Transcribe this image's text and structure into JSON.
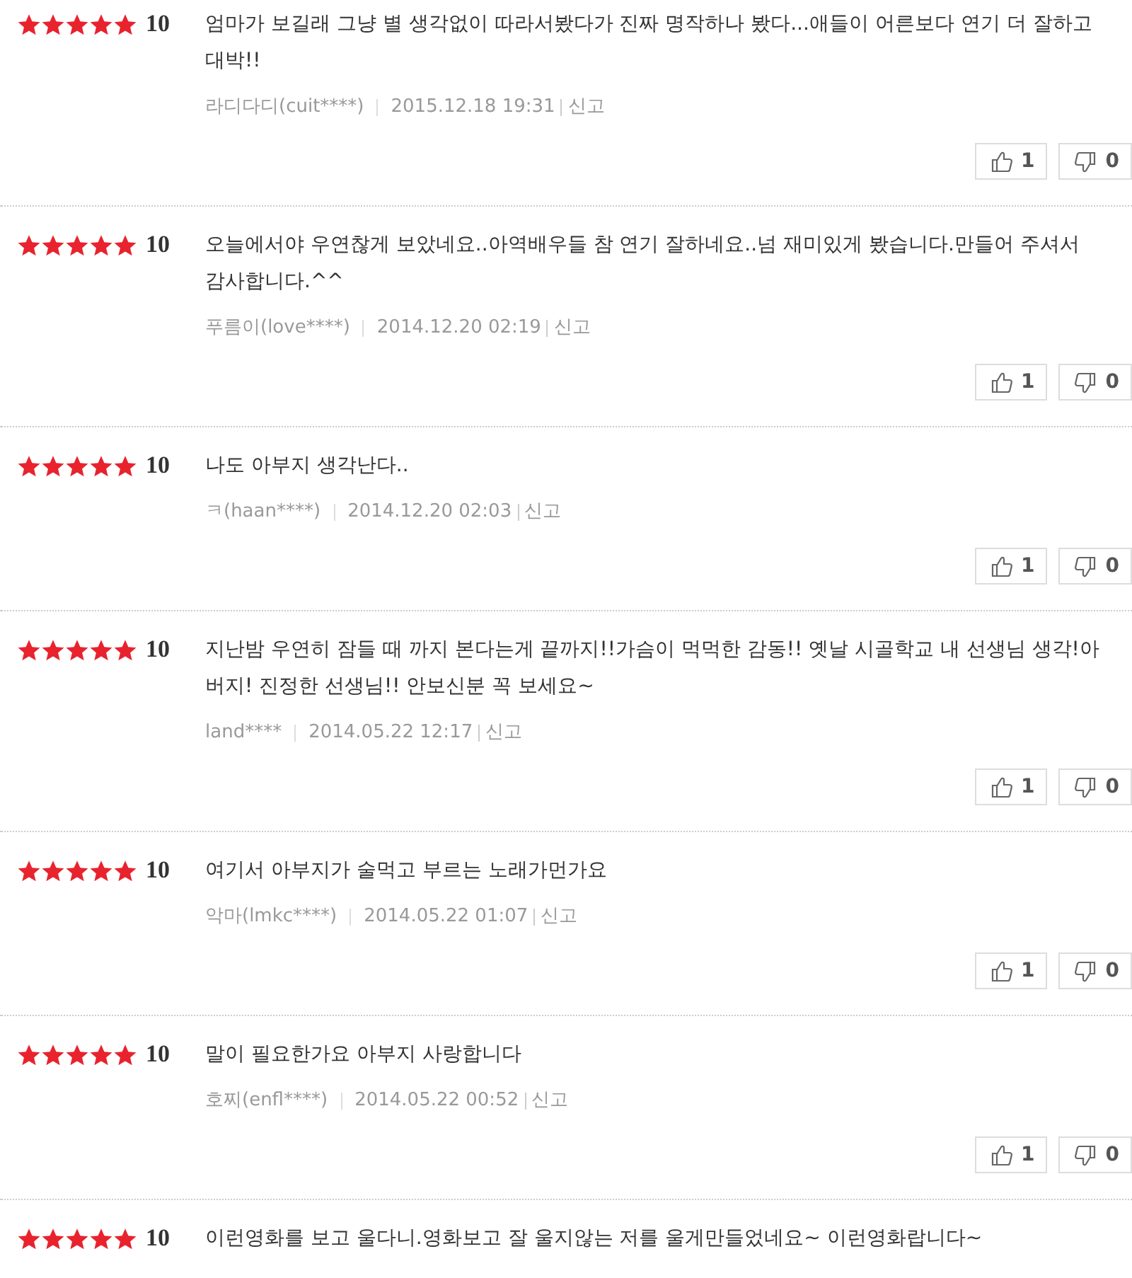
{
  "reviews": [
    {
      "stars": 5,
      "score": "10",
      "text": "엄마가 보길래 그냥 별 생각없이 따라서봤다가 진짜 명작하나 봤다...애들이 어른보다 연기 더 잘하고 대박!!",
      "author": "라디다디(cuit****)",
      "date": "2015.12.18 19:31",
      "report": "신고",
      "likes": "1",
      "dislikes": "0"
    },
    {
      "stars": 5,
      "score": "10",
      "text": "오늘에서야 우연찮게 보았네요..아역배우들 참 연기 잘하네요..넘 재미있게 봤습니다.만들어 주셔서 감사합니다.^^",
      "author": "푸름이(love****)",
      "date": "2014.12.20 02:19",
      "report": "신고",
      "likes": "1",
      "dislikes": "0"
    },
    {
      "stars": 5,
      "score": "10",
      "text": "나도 아부지 생각난다..",
      "author": "ㅋ(haan****)",
      "date": "2014.12.20 02:03",
      "report": "신고",
      "likes": "1",
      "dislikes": "0"
    },
    {
      "stars": 5,
      "score": "10",
      "text": "지난밤 우연히 잠들 때 까지 본다는게 끝까지!!가슴이 먹먹한 감동!! 옛날 시골학교 내 선생님 생각!아버지! 진정한 선생님!! 안보신분 꼭 보세요~",
      "author": "land****",
      "date": "2014.05.22 12:17",
      "report": "신고",
      "likes": "1",
      "dislikes": "0"
    },
    {
      "stars": 5,
      "score": "10",
      "text": "여기서 아부지가 술먹고 부르는 노래가먼가요",
      "author": "악마(lmkc****)",
      "date": "2014.05.22 01:07",
      "report": "신고",
      "likes": "1",
      "dislikes": "0"
    },
    {
      "stars": 5,
      "score": "10",
      "text": "말이 필요한가요 아부지 사랑합니다",
      "author": "호찌(enfl****)",
      "date": "2014.05.22 00:52",
      "report": "신고",
      "likes": "1",
      "dislikes": "0"
    },
    {
      "stars": 5,
      "score": "10",
      "text": "이런영화를 보고 울다니.영화보고 잘 울지않는 저를 울게만들었네요~ 이런영화랍니다~"
    }
  ]
}
